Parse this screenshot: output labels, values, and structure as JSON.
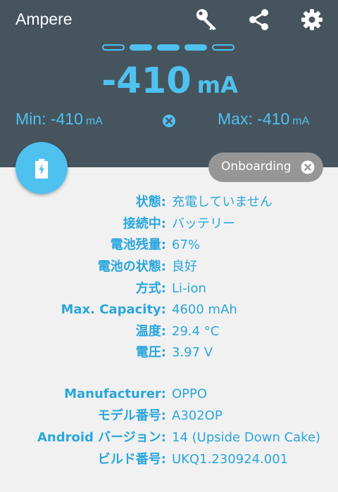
{
  "app": {
    "title": "Ampere"
  },
  "toolbar": {
    "icons": [
      "key-icon",
      "share-icon",
      "gear-icon"
    ]
  },
  "pager": {
    "count": 5,
    "active": [
      1,
      2,
      3
    ]
  },
  "current": {
    "value": "-410",
    "unit": "mA"
  },
  "stats": {
    "min_label": "Min: -410",
    "min_unit": "mA",
    "max_label": "Max: -410",
    "max_unit": "mA"
  },
  "chip": {
    "label": "Onboarding"
  },
  "colors": {
    "header": "#46545e",
    "accent": "#4fc1ef",
    "label": "#2aa6dc",
    "chip": "#969696",
    "background": "#f1f1f1"
  },
  "battery_info": [
    {
      "label": "状態:",
      "value": "充電していません"
    },
    {
      "label": "接続中:",
      "value": "バッテリー"
    },
    {
      "label": "電池残量:",
      "value": "67%"
    },
    {
      "label": "電池の状態:",
      "value": "良好"
    },
    {
      "label": "方式:",
      "value": "Li-ion"
    },
    {
      "label": "Max. Capacity:",
      "value": "4600 mAh"
    },
    {
      "label": "温度:",
      "value": "29.4 °C"
    },
    {
      "label": "電圧:",
      "value": "3.97 V"
    }
  ],
  "device_info": [
    {
      "label": "Manufacturer:",
      "value": "OPPO"
    },
    {
      "label": "モデル番号:",
      "value": "A302OP"
    },
    {
      "label": "Android バージョン:",
      "value": "14 (Upside Down Cake)"
    },
    {
      "label": "ビルド番号:",
      "value": "UKQ1.230924.001"
    }
  ]
}
